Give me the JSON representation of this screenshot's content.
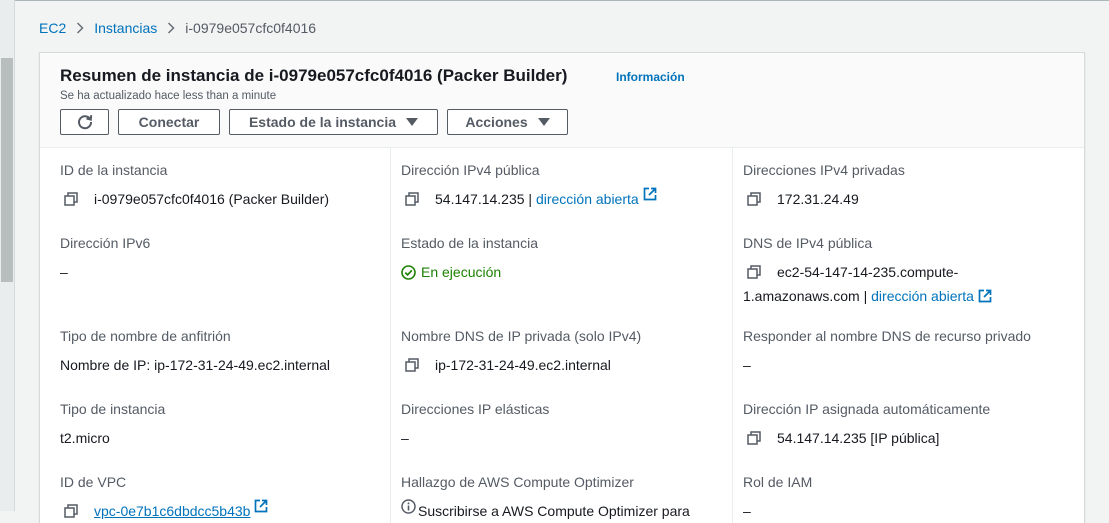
{
  "breadcrumb": {
    "items": [
      "EC2",
      "Instancias"
    ],
    "current": "i-0979e057cfc0f4016"
  },
  "summary": {
    "title": "Resumen de instancia de i-0979e057cfc0f4016 (Packer Builder)",
    "info_link": "Información",
    "updated": "Se ha actualizado hace less than a minute"
  },
  "toolbar": {
    "refresh_icon": "refresh-icon",
    "connect": "Conectar",
    "instance_state": "Estado de la instancia",
    "actions": "Acciones"
  },
  "details": {
    "instance_id": {
      "label": "ID de la instancia",
      "value": "i-0979e057cfc0f4016 (Packer Builder)"
    },
    "public_ipv4": {
      "label": "Dirección IPv4 pública",
      "value": "54.147.14.235 |",
      "link": "dirección abierta"
    },
    "private_ipv4": {
      "label": "Direcciones IPv4 privadas",
      "value": "172.31.24.49"
    },
    "ipv6": {
      "label": "Dirección IPv6",
      "value": "–"
    },
    "instance_state": {
      "label": "Estado de la instancia",
      "value": "En ejecución"
    },
    "public_dns": {
      "label": "DNS de IPv4 pública",
      "value_line1": "ec2-54-147-14-235.compute-",
      "value_line2": "1.amazonaws.com |",
      "link": "dirección abierta"
    },
    "hostname_type": {
      "label": "Tipo de nombre de anfitrión",
      "value": "Nombre de IP: ip-172-31-24-49.ec2.internal"
    },
    "private_dns": {
      "label": "Nombre DNS de IP privada (solo IPv4)",
      "value": "ip-172-31-24-49.ec2.internal"
    },
    "answer_dns": {
      "label": "Responder al nombre DNS de recurso privado",
      "value": "–"
    },
    "instance_type": {
      "label": "Tipo de instancia",
      "value": "t2.micro"
    },
    "elastic_ip": {
      "label": "Direcciones IP elásticas",
      "value": "–"
    },
    "auto_ip": {
      "label": "Dirección IP asignada automáticamente",
      "value": "54.147.14.235 [IP pública]"
    },
    "vpc_id": {
      "label": "ID de VPC",
      "value": "vpc-0e7b1c6dbdcc5b43b"
    },
    "compute_optimizer": {
      "label": "Hallazgo de AWS Compute Optimizer",
      "value": "Suscribirse a AWS Compute Optimizer para"
    },
    "iam_role": {
      "label": "Rol de IAM",
      "value": "–"
    }
  },
  "colors": {
    "link": "#0073bb",
    "running": "#1d8102",
    "text": "#16191f",
    "label": "#545b64"
  }
}
